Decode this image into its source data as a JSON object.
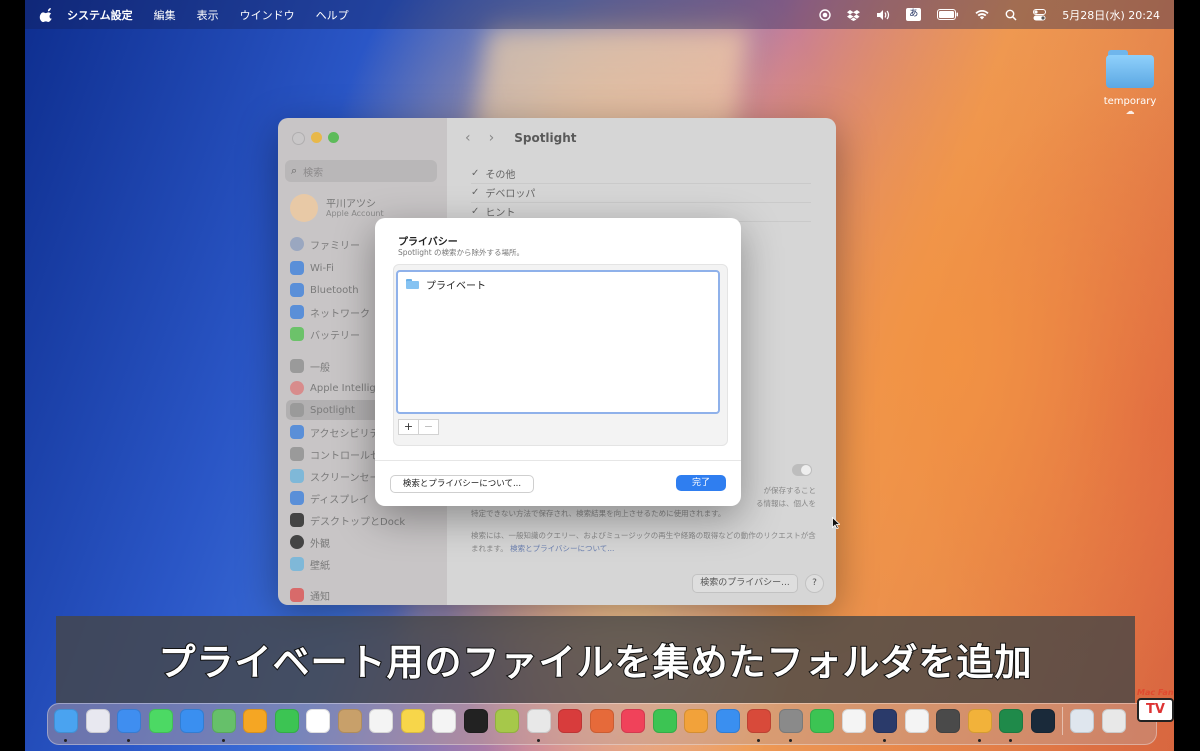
{
  "menubar": {
    "app_name": "システム設定",
    "menus": [
      "編集",
      "表示",
      "ウインドウ",
      "ヘルプ"
    ],
    "input_mode": "あ",
    "datetime": "5月28日(水)  20:24"
  },
  "desktop": {
    "folder_label": "temporary"
  },
  "settings_window": {
    "search_placeholder": "検索",
    "account": {
      "name": "平川アツシ",
      "subtitle": "Apple Account"
    },
    "sidebar_items": [
      {
        "label": "ファミリー",
        "color": "#9aa7c0"
      },
      {
        "label": "Wi-Fi",
        "color": "#5a8fd8"
      },
      {
        "label": "Bluetooth",
        "color": "#5a8fd8"
      },
      {
        "label": "ネットワーク",
        "color": "#5a8fd8"
      },
      {
        "label": "バッテリー",
        "color": "#6cc26a"
      },
      {
        "label": "一般",
        "color": "#9a9a9a"
      },
      {
        "label": "Apple Intelligence",
        "color": "#d88c8c"
      },
      {
        "label": "Spotlight",
        "color": "#9a9a9a"
      },
      {
        "label": "アクセシビリティ",
        "color": "#5a8fd8"
      },
      {
        "label": "コントロールセンター",
        "color": "#9a9a9a"
      },
      {
        "label": "スクリーンセーバ",
        "color": "#7fb8d8"
      },
      {
        "label": "ディスプレイ",
        "color": "#5a8fd8"
      },
      {
        "label": "デスクトップとDock",
        "color": "#444444"
      },
      {
        "label": "外観",
        "color": "#444444"
      },
      {
        "label": "壁紙",
        "color": "#7fb8d8"
      },
      {
        "label": "通知",
        "color": "#d86a6a"
      }
    ],
    "main_title": "Spotlight",
    "check_items": [
      "その他",
      "デベロッパ",
      "ヒント"
    ],
    "info_fragments": [
      "が保存すること",
      "る情報は、個人を",
      "特定できない方法で保存され、検索結果を向上させるために使用されます。"
    ],
    "info_paragraph": "検索には、一般知識のクエリー、およびミュージックの再生や経路の取得などの動作のリクエストが含まれます。",
    "info_link": "検索とプライバシーについて...",
    "privacy_button": "検索のプライバシー...",
    "help_button": "?"
  },
  "sheet": {
    "title": "プライバシー",
    "subtitle": "Spotlight の検索から除外する場所。",
    "items": [
      "プライベート"
    ],
    "add_button": "+",
    "remove_button": "−",
    "about_button": "検索とプライバシーについて...",
    "done_button": "完了"
  },
  "caption": "プライベート用のファイルを集めたフォルダを追加",
  "dock": {
    "apps": [
      {
        "name": "finder-icon",
        "color": "#4aa3f0",
        "running": true
      },
      {
        "name": "launchpad-icon",
        "color": "#e8e8f0",
        "running": false
      },
      {
        "name": "safari-icon",
        "color": "#3f8ef0",
        "running": true
      },
      {
        "name": "messages-icon",
        "color": "#4cd964",
        "running": false
      },
      {
        "name": "mail-icon",
        "color": "#3a8ff0",
        "running": false
      },
      {
        "name": "maps-icon",
        "color": "#66c06a",
        "running": true
      },
      {
        "name": "photos-icon",
        "color": "#f5a623",
        "running": false
      },
      {
        "name": "facetime-icon",
        "color": "#3cc453",
        "running": false
      },
      {
        "name": "calendar-icon",
        "color": "#ffffff",
        "running": false
      },
      {
        "name": "contacts-icon",
        "color": "#c8a06a",
        "running": false
      },
      {
        "name": "reminders-icon",
        "color": "#f4f4f4",
        "running": false
      },
      {
        "name": "notes-icon",
        "color": "#f7d64a",
        "running": false
      },
      {
        "name": "freeform-icon",
        "color": "#f4f4f4",
        "running": false
      },
      {
        "name": "appletv-icon",
        "color": "#222222",
        "running": false
      },
      {
        "name": "numbers-like-icon",
        "color": "#a6c84a",
        "running": false
      },
      {
        "name": "chrome-icon",
        "color": "#e8e8e8",
        "running": true
      },
      {
        "name": "affinity-icon",
        "color": "#d83c3c",
        "running": false
      },
      {
        "name": "pixelmator-icon",
        "color": "#e66a3a",
        "running": false
      },
      {
        "name": "music-icon",
        "color": "#f0425a",
        "running": false
      },
      {
        "name": "numbers-icon",
        "color": "#3cc453",
        "running": false
      },
      {
        "name": "pages-icon",
        "color": "#f2a23a",
        "running": false
      },
      {
        "name": "appstore-icon",
        "color": "#3a8ff0",
        "running": false
      },
      {
        "name": "xcode-like-icon",
        "color": "#d84a3a",
        "running": true
      },
      {
        "name": "system-settings-icon",
        "color": "#8a8a8a",
        "running": true
      },
      {
        "name": "line-icon",
        "color": "#3cc453",
        "running": false
      },
      {
        "name": "star-app-icon",
        "color": "#f4f4f4",
        "running": false
      },
      {
        "name": "iphone-mirroring-icon",
        "color": "#2a3a6a",
        "running": true
      },
      {
        "name": "chatgpt-icon",
        "color": "#f4f4f4",
        "running": false
      },
      {
        "name": "calculator-icon",
        "color": "#4a4a4a",
        "running": false
      },
      {
        "name": "typora-icon",
        "color": "#f2b23a",
        "running": true
      },
      {
        "name": "excel-icon",
        "color": "#1f8a4a",
        "running": true
      },
      {
        "name": "perplexity-icon",
        "color": "#1a2a3a",
        "running": false
      }
    ],
    "trailing": [
      {
        "name": "downloads-icon",
        "color": "#dfe6ee"
      },
      {
        "name": "trash-icon",
        "color": "#e8e8e8"
      }
    ]
  },
  "watermark": {
    "line1": "Mac Fan",
    "line2": "TV"
  }
}
